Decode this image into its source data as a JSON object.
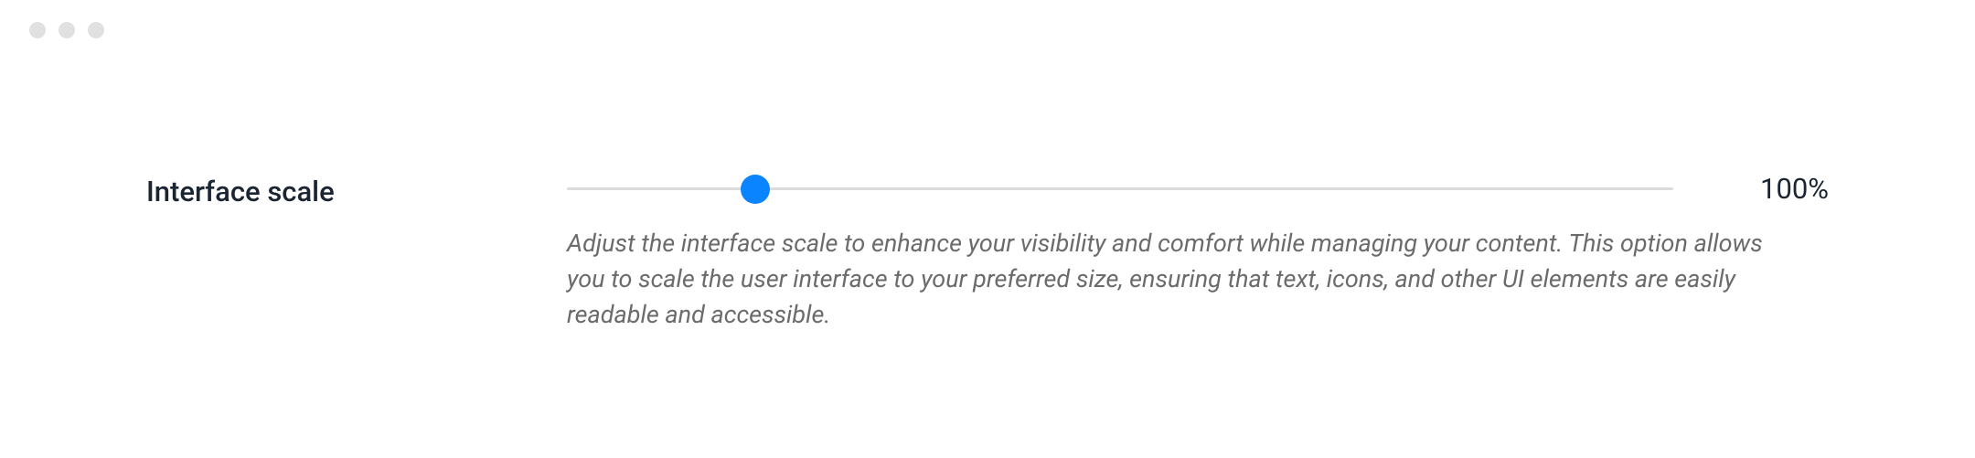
{
  "setting": {
    "label": "Interface scale",
    "value_display": "100%",
    "description": "Adjust the interface scale to enhance your visibility and comfort while managing your content. This option allows you to scale the user interface to your preferred size, ensuring that text, icons, and other UI elements are easily readable and accessible."
  }
}
